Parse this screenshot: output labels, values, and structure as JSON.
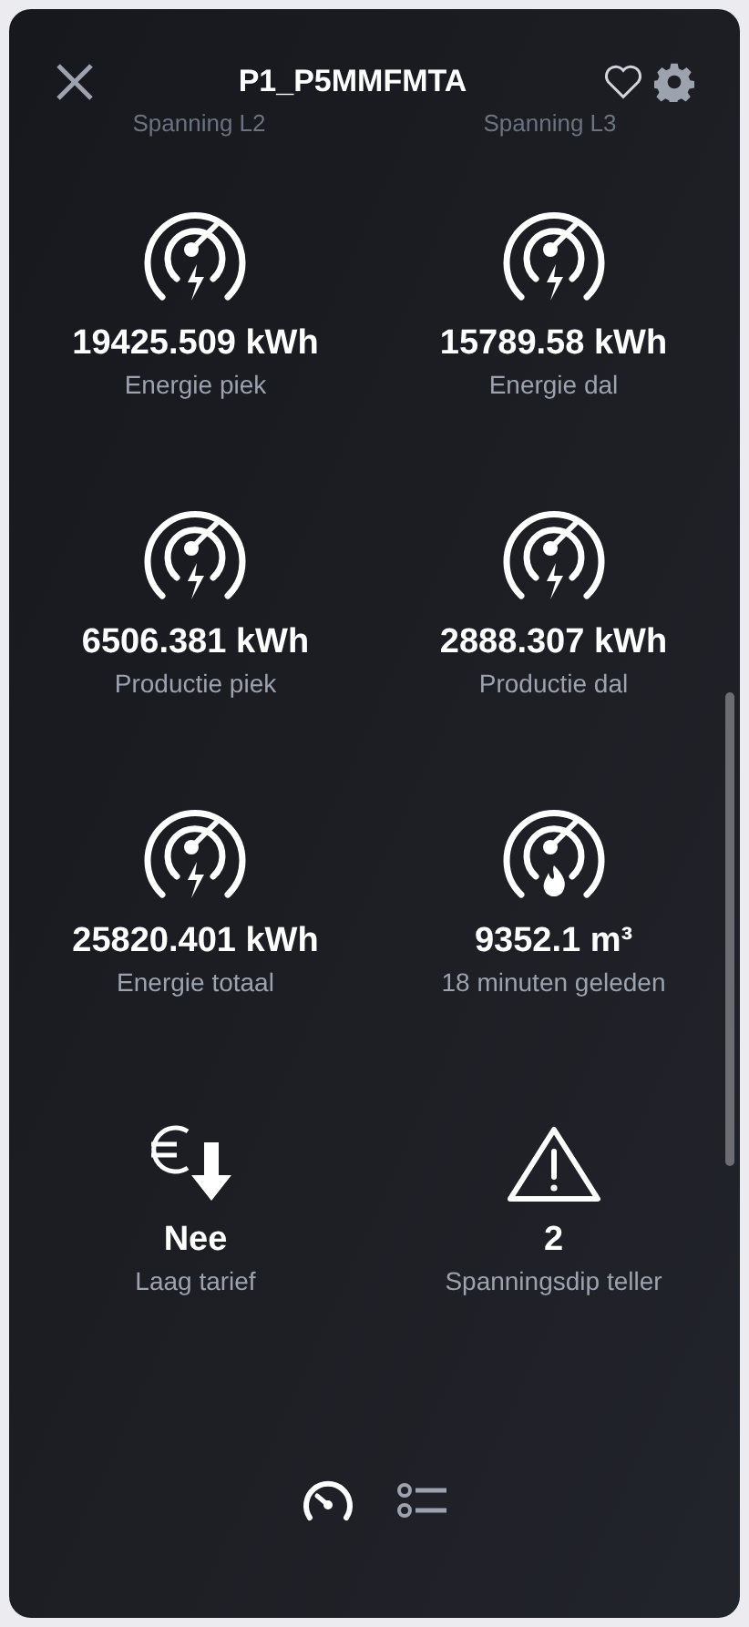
{
  "header": {
    "title": "P1_P5MMFMTA"
  },
  "partial_labels": [
    "Spanning L2",
    "Spanning L3"
  ],
  "tiles": [
    {
      "kind": "gauge-bolt",
      "value": "19425.509 kWh",
      "label": "Energie piek"
    },
    {
      "kind": "gauge-bolt",
      "value": "15789.58 kWh",
      "label": "Energie dal"
    },
    {
      "kind": "gauge-bolt",
      "value": "6506.381 kWh",
      "label": "Productie piek"
    },
    {
      "kind": "gauge-bolt",
      "value": "2888.307 kWh",
      "label": "Productie dal"
    },
    {
      "kind": "gauge-bolt",
      "value": "25820.401 kWh",
      "label": "Energie totaal"
    },
    {
      "kind": "gauge-flame",
      "value": "9352.1 m³",
      "label": "18 minuten geleden"
    },
    {
      "kind": "euro-down",
      "value": "Nee",
      "label": "Laag tarief"
    },
    {
      "kind": "warning",
      "value": "2",
      "label": "Spanningsdip teller"
    }
  ],
  "tabs": [
    {
      "kind": "gauge",
      "selected": true
    },
    {
      "kind": "list",
      "selected": false
    }
  ]
}
